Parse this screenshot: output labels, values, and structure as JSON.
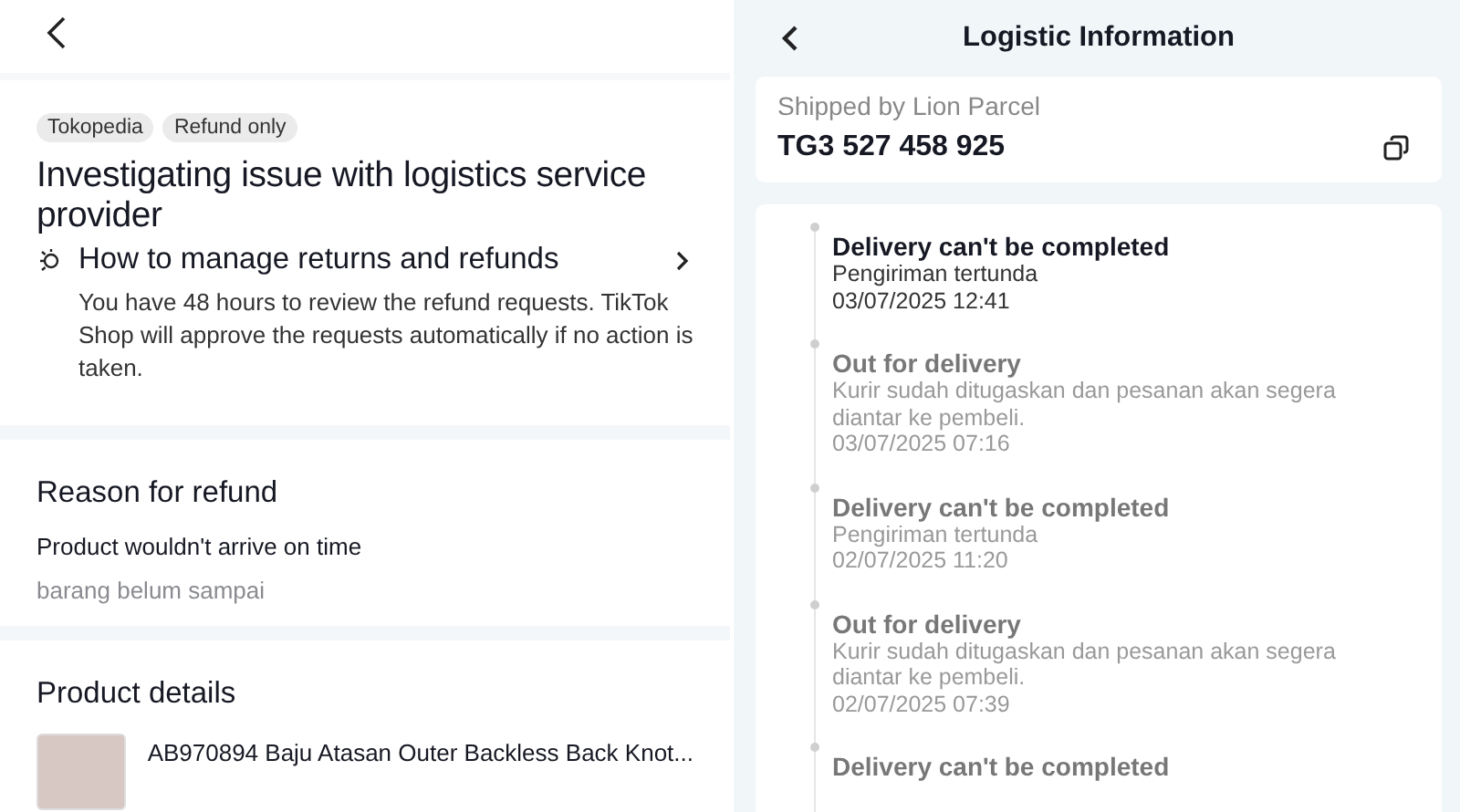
{
  "refund_page": {
    "tags": [
      "Tokopedia",
      "Refund only"
    ],
    "title": "Investigating issue with logistics service provider",
    "guide": {
      "title": "How to manage returns and refunds",
      "description": "You have 48 hours to review the refund requests. TikTok Shop will approve the requests automatically if no action is taken."
    },
    "reason": {
      "heading": "Reason for refund",
      "reason": "Product wouldn't arrive on time",
      "note": "barang belum sampai"
    },
    "product": {
      "heading": "Product details",
      "name": "AB970894 Baju Atasan Outer Backless Back Knot..."
    }
  },
  "logistics_page": {
    "title": "Logistic Information",
    "carrier": "Shipped by Lion Parcel",
    "tracking_number": "TG3 527 458 925",
    "events": [
      {
        "status": "Delivery can't be completed",
        "detail": "Pengiriman tertunda",
        "time": "03/07/2025 12:41",
        "current": true
      },
      {
        "status": "Out for delivery",
        "detail": "Kurir sudah ditugaskan dan pesanan akan segera diantar ke pembeli.",
        "time": "03/07/2025 07:16",
        "current": false
      },
      {
        "status": "Delivery can't be completed",
        "detail": "Pengiriman tertunda",
        "time": "02/07/2025 11:20",
        "current": false
      },
      {
        "status": "Out for delivery",
        "detail": "Kurir sudah ditugaskan dan pesanan akan segera diantar ke pembeli.",
        "time": "02/07/2025 07:39",
        "current": false
      },
      {
        "status": "Delivery can't be completed",
        "current": false
      }
    ]
  }
}
